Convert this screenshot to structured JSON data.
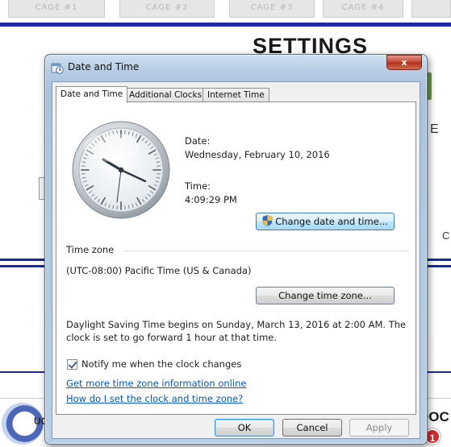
{
  "background": {
    "tabs": [
      "CAGE #1",
      "CAGE #2",
      "CAGE #3",
      "CAGE #4"
    ],
    "page_title": "SETTINGS",
    "fragment_e": "E",
    "fragment_c": "C",
    "footer_left": "UG",
    "footer_right": "DOC",
    "notification_count": "1",
    "accent_color": "#1d28a8"
  },
  "dialog": {
    "title": "Date and Time",
    "close_label": "x",
    "tabs": [
      {
        "label": "Date and Time",
        "active": true
      },
      {
        "label": "Additional Clocks",
        "active": false
      },
      {
        "label": "Internet Time",
        "active": false
      }
    ],
    "date_label": "Date:",
    "date_value": "Wednesday, February 10, 2016",
    "time_label": "Time:",
    "time_value": "4:09:29 PM",
    "change_date_button": "Change date and time...",
    "timezone_heading": "Time zone",
    "timezone_value": "(UTC-08:00) Pacific Time (US & Canada)",
    "change_timezone_button": "Change time zone...",
    "dst_line1": "Daylight Saving Time begins on Sunday, March 13, 2016 at 2:00 AM. The",
    "dst_line2": "clock is set to go forward 1 hour at that time.",
    "notify_label": "Notify me when the clock changes",
    "notify_checked": true,
    "link1": "Get more time zone information online",
    "link2": "How do I set the clock and time zone?",
    "ok_button": "OK",
    "cancel_button": "Cancel",
    "apply_button": "Apply",
    "apply_enabled": false
  }
}
